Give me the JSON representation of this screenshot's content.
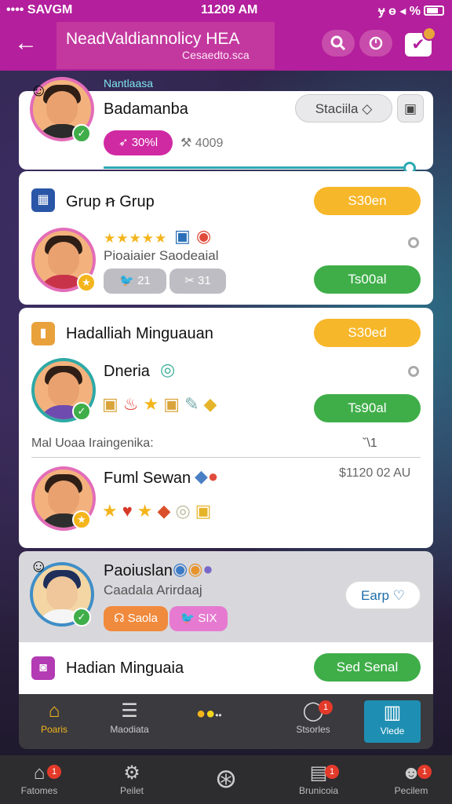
{
  "status": {
    "carrier": "•••• SAVGM",
    "time": "11209 AM",
    "right": "ɏ ɵ ◂ %"
  },
  "header": {
    "back_glyph": "←",
    "title": "NeadValdiannolicy HEA",
    "subtitle": "Cesaedto.sca",
    "notif_glyph": "✔"
  },
  "profile": {
    "top_label": "Nantlaasa",
    "name": "Badamanba",
    "status_button": "Staciila",
    "tag1": "30%l",
    "tag2": "4009"
  },
  "group1": {
    "title": "Grup ꞥ Grup",
    "action": "S30en",
    "member_name": "Pioaiaier Saodeaial",
    "tag1": "21",
    "tag2": "31",
    "join": "Ts00al"
  },
  "group2": {
    "title": "Hadalliah Minguauan",
    "action": "S30ed",
    "member_name": "Dneria",
    "join": "Ts90al",
    "divider_label": "Mal Uoaa Iraingenika:",
    "divider_right": "ˇ\\1",
    "member2_name": "Fuml Sewan",
    "member2_amount": "$1120 02 AU"
  },
  "gray_card": {
    "name": "Paoiuslan",
    "sub": "Caadala Arirdaaj",
    "tag1": "Saola",
    "tag2": "SIX",
    "button": "Earp"
  },
  "bottom_card": {
    "title": "Hadian Minguaia",
    "button": "Sed Senal"
  },
  "tabs": [
    {
      "label": "Poaris",
      "icon": "home-icon"
    },
    {
      "label": "Maodiata",
      "icon": "list-icon"
    },
    {
      "label": "Stsorles",
      "icon": "chat-icon"
    },
    {
      "label": "Vlede",
      "icon": "book-icon"
    }
  ],
  "nav": [
    {
      "label": "Fatomes",
      "badge": "1"
    },
    {
      "label": "Peilet",
      "badge": ""
    },
    {
      "label": "Brunicoia",
      "badge": "1"
    },
    {
      "label": "Pecilem",
      "badge": "1"
    }
  ],
  "colors": {
    "brand": "#b31f9c",
    "orange": "#f7b72a",
    "green": "#3fae49"
  }
}
